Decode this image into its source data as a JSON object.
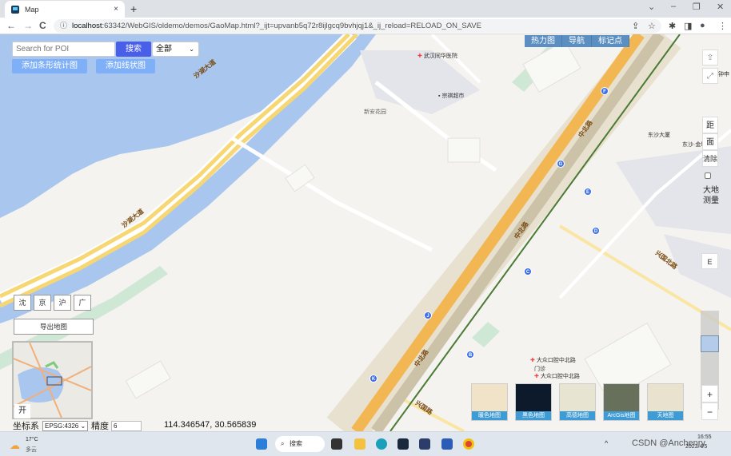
{
  "browser": {
    "tab_title": "Map",
    "tab_close": "×",
    "new_tab": "+",
    "url_host": "localhost",
    "url_rest": ":63342/WebGIS/oldemo/demos/GaoMap.html?_ijt=upvanb5q72r8ijlgcq9bvhjqj1&_ij_reload=RELOAD_ON_SAVE",
    "window_controls": {
      "dropdown": "⌄",
      "minimize": "–",
      "restore": "❐",
      "close": "✕"
    },
    "nav": {
      "back": "←",
      "forward": "→",
      "reload": "C",
      "info": "ⓘ"
    },
    "toolbar_icons": {
      "share": "⇪",
      "star": "☆",
      "extensions": "✱",
      "sidepanel": "◨",
      "profile": "●",
      "menu": "⋮"
    }
  },
  "search": {
    "placeholder": "Search for POI",
    "button": "搜索",
    "category_selected": "全部"
  },
  "action_buttons": {
    "bar_chart": "添加条形统计图",
    "line_chart": "添加线状图"
  },
  "top_tabs": [
    "热力图",
    "导航",
    "标记点"
  ],
  "right_controls": {
    "north": "⇧",
    "fullscreen": "⤢",
    "distance": "距",
    "area": "面",
    "clear": "清除",
    "geodesic_label_1": "大地",
    "geodesic_label_2": "测量",
    "e_button": "E",
    "zoom_in": "+",
    "zoom_out": "−",
    "zoom_level_fraction": 0.3
  },
  "city_buttons": [
    "沈",
    "京",
    "沪",
    "广"
  ],
  "export_button": "导出地图",
  "overview_toggle": "开",
  "coordinate": {
    "label": "坐标系",
    "crs": "EPSG:4326",
    "precision_label": "精度",
    "precision_value": "6",
    "readout": "114.346547, 30.565839"
  },
  "basemaps": [
    {
      "label": "暖色地图",
      "color": "#f1e3c8"
    },
    {
      "label": "黑色地图",
      "color": "#0c1a2c"
    },
    {
      "label": "高德地图",
      "color": "#e8e4d2"
    },
    {
      "label": "ArcGis地图",
      "color": "#66705a"
    },
    {
      "label": "天地图",
      "color": "#e9e2cf"
    }
  ],
  "map_labels": {
    "hospital": "武汉同华医院",
    "supermarket": "宗祺超市",
    "garden": "新安花园",
    "road_shahu_1": "沙湖大道",
    "road_shahu_2": "沙湖大道",
    "road_zhongbei_1": "中北路",
    "road_zhongbei_2": "中北路",
    "road_zhongbei_3": "中北路",
    "road_xingguo": "兴国路",
    "road_xingguo_north": "兴国北路",
    "poi_east_1": "东沙大厦",
    "poi_east_2": "东沙·金城",
    "poi_clinic_1": "大众口腔中北路",
    "poi_clinic_2": "门诊",
    "poi_clinic_3": "大众口腔中北路",
    "poi_edge": "钟申"
  },
  "stations": [
    "F",
    "G",
    "E",
    "D",
    "C",
    "J",
    "B",
    "K"
  ],
  "taskbar": {
    "weather_temp": "17°C",
    "weather_desc": "多云",
    "search": "搜索",
    "time": "16:55",
    "date": "2023/4/5",
    "watermark": "CSDN @Anchenry"
  }
}
